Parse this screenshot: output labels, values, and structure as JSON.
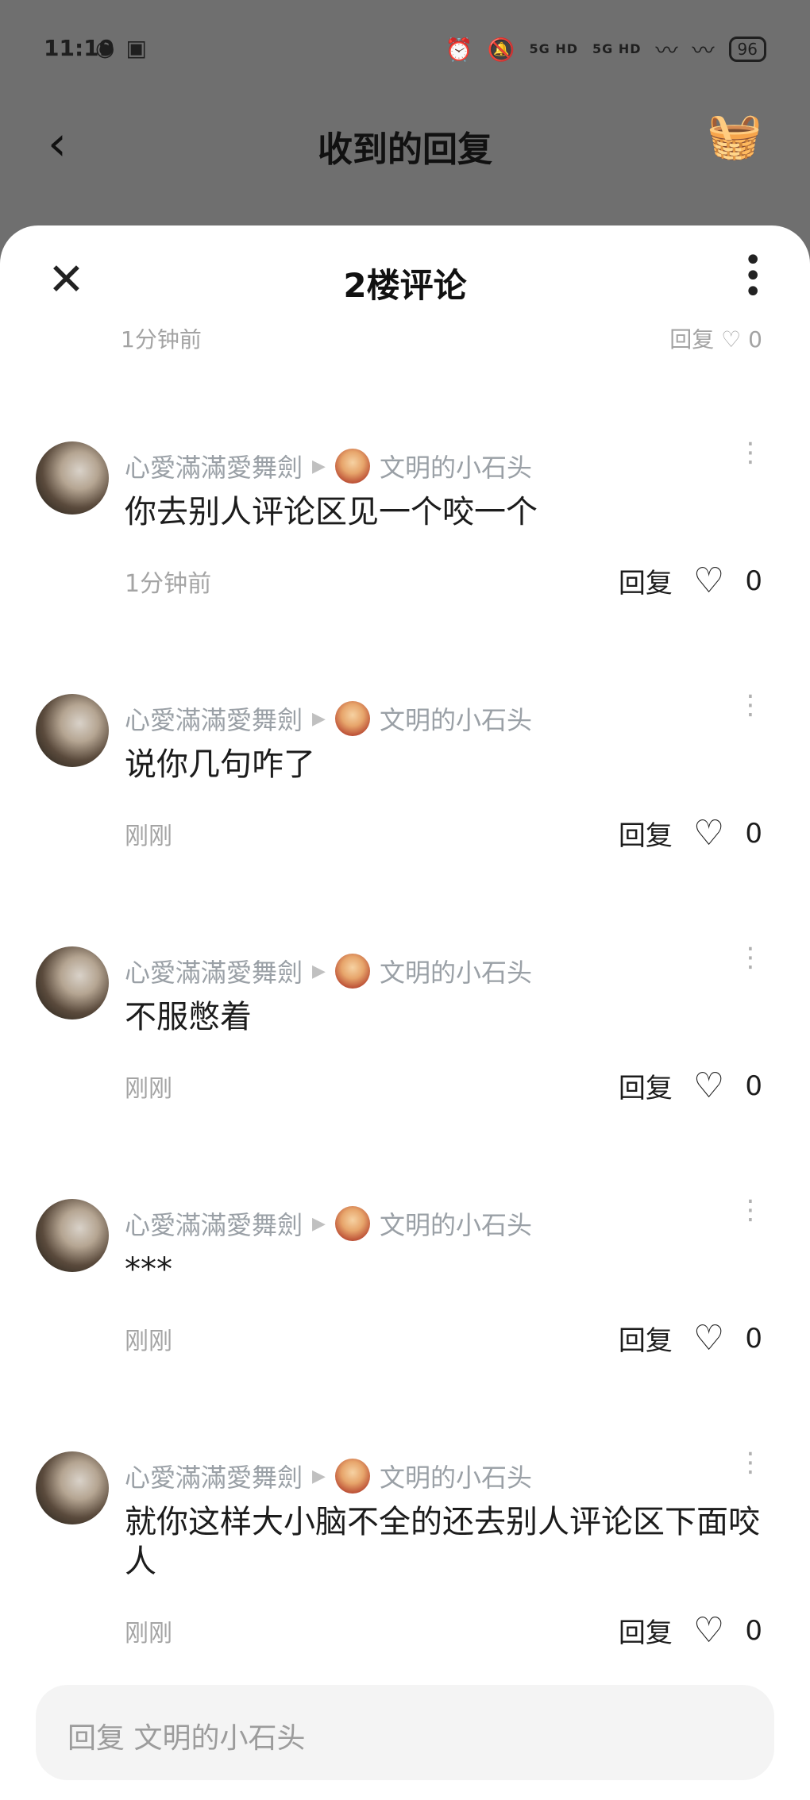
{
  "status_bar": {
    "time": "11:19",
    "signal_1": "5G HD",
    "signal_2": "5G HD",
    "battery": "96"
  },
  "topbar": {
    "title": "收到的回复"
  },
  "sheet": {
    "title": "2楼评论"
  },
  "partial_row": {
    "time": "1分钟前",
    "reply_label": "回复",
    "like_count": "0"
  },
  "comments": [
    {
      "author": "心愛滿滿愛舞劍",
      "reply_to": "文明的小石头",
      "text": "你去别人评论区见一个咬一个",
      "time": "1分钟前",
      "reply_label": "回复",
      "like_count": "0"
    },
    {
      "author": "心愛滿滿愛舞劍",
      "reply_to": "文明的小石头",
      "text": "说你几句咋了",
      "time": "刚刚",
      "reply_label": "回复",
      "like_count": "0"
    },
    {
      "author": "心愛滿滿愛舞劍",
      "reply_to": "文明的小石头",
      "text": "不服憋着",
      "time": "刚刚",
      "reply_label": "回复",
      "like_count": "0"
    },
    {
      "author": "心愛滿滿愛舞劍",
      "reply_to": "文明的小石头",
      "text": "***",
      "time": "刚刚",
      "reply_label": "回复",
      "like_count": "0"
    },
    {
      "author": "心愛滿滿愛舞劍",
      "reply_to": "文明的小石头",
      "text": "就你这样大小脑不全的还去别人评论区下面咬人",
      "time": "刚刚",
      "reply_label": "回复",
      "like_count": "0"
    }
  ],
  "reply_input": {
    "placeholder": "回复 文明的小石头"
  }
}
